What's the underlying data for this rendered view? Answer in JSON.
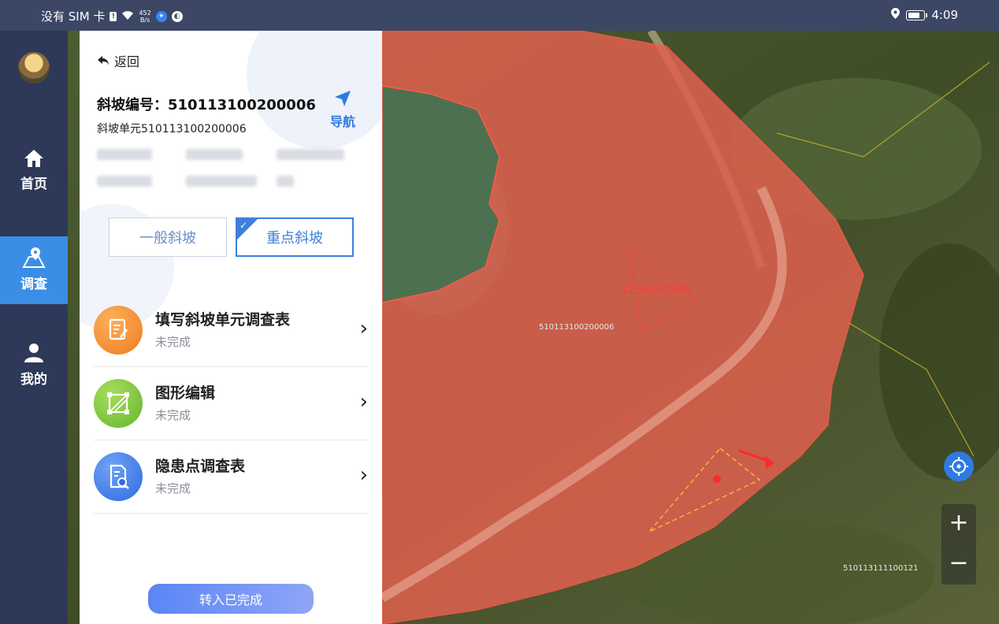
{
  "statusbar": {
    "carrier": "没有 SIM 卡",
    "net_speed": "452",
    "net_unit": "B/s",
    "time": "4:09"
  },
  "rail": {
    "items": [
      {
        "label": "首页",
        "icon": "home-icon"
      },
      {
        "label": "调查",
        "icon": "map-survey-icon",
        "active": true
      },
      {
        "label": "我的",
        "icon": "user-icon"
      }
    ]
  },
  "panel": {
    "back_label": "返回",
    "slope_title": "斜坡编号：510113100200006",
    "slope_unit": "斜坡单元510113100200006",
    "nav_label": "导航",
    "segments": [
      "一般斜坡",
      "重点斜坡"
    ],
    "selected_segment": "重点斜坡",
    "tasks": [
      {
        "title": "填写斜坡单元调查表",
        "status": "未完成",
        "icon": "form-edit-icon",
        "color": "#f28a2e"
      },
      {
        "title": "图形编辑",
        "status": "未完成",
        "icon": "shape-edit-icon",
        "color": "#7cc43a"
      },
      {
        "title": "隐患点调查表",
        "status": "未完成",
        "icon": "doc-search-icon",
        "color": "#3f7fe6"
      }
    ],
    "complete_button": "转入已完成"
  },
  "map": {
    "polygon_label": "510113100200006",
    "triangle_label": "1234567890",
    "corner_label": "510113111100121",
    "polygon_color": "#e0604f",
    "zoom_in": "+",
    "zoom_out": "−"
  }
}
